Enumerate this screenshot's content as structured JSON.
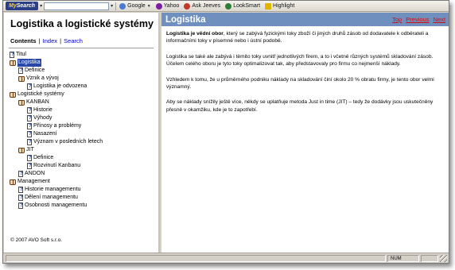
{
  "toolbar": {
    "logo_my": "My",
    "logo_search": "Search",
    "search_placeholder": "",
    "buttons": [
      {
        "label": "Google",
        "icon": "search-icon",
        "color": "#4a7bd0"
      },
      {
        "label": "Yahoo",
        "icon": "search-icon",
        "color": "#7b1fa2"
      },
      {
        "label": "Ask Jeeves",
        "icon": "search-icon",
        "color": "#c0392b"
      },
      {
        "label": "LookSmart",
        "icon": "search-icon",
        "color": "#2e7d32"
      },
      {
        "label": "Highlight",
        "icon": "highlighter-icon",
        "color": "#e0b400"
      }
    ]
  },
  "left_pane": {
    "title": "Logistika a logistické systémy",
    "nav": {
      "contents": "Contents",
      "index": "Index",
      "search": "Search",
      "separator": "|"
    },
    "tree": [
      {
        "label": "Titul",
        "icon": "page",
        "level": 0,
        "selected": false
      },
      {
        "label": "Logistika",
        "icon": "book",
        "level": 0,
        "selected": true
      },
      {
        "label": "Definice",
        "icon": "page",
        "level": 1,
        "selected": false
      },
      {
        "label": "Vznik a vývoj",
        "icon": "book",
        "level": 1,
        "selected": false
      },
      {
        "label": "Logistika je odvozena",
        "icon": "page",
        "level": 2,
        "selected": false
      },
      {
        "label": "Logistické systémy",
        "icon": "book",
        "level": 0,
        "selected": false
      },
      {
        "label": "KANBAN",
        "icon": "book",
        "level": 1,
        "selected": false
      },
      {
        "label": "Historie",
        "icon": "page",
        "level": 2,
        "selected": false
      },
      {
        "label": "Výhody",
        "icon": "page",
        "level": 2,
        "selected": false
      },
      {
        "label": "Přínosy a problémy",
        "icon": "page",
        "level": 2,
        "selected": false
      },
      {
        "label": "Nasazení",
        "icon": "page",
        "level": 2,
        "selected": false
      },
      {
        "label": "Význam v posledních letech",
        "icon": "page",
        "level": 2,
        "selected": false
      },
      {
        "label": "JIT",
        "icon": "book",
        "level": 1,
        "selected": false
      },
      {
        "label": "Definice",
        "icon": "page",
        "level": 2,
        "selected": false
      },
      {
        "label": "Rozvinutí Kanbanu",
        "icon": "page",
        "level": 2,
        "selected": false
      },
      {
        "label": "ANDON",
        "icon": "page",
        "level": 1,
        "selected": false
      },
      {
        "label": "Management",
        "icon": "book",
        "level": 0,
        "selected": false
      },
      {
        "label": "Historie managementu",
        "icon": "page",
        "level": 1,
        "selected": false
      },
      {
        "label": "Dělení managementu",
        "icon": "page",
        "level": 1,
        "selected": false
      },
      {
        "label": "Osobnosti managementu",
        "icon": "page",
        "level": 1,
        "selected": false
      }
    ],
    "copyright": "© 2007 AVO Soft s.r.o."
  },
  "content": {
    "title": "Logistika",
    "nav": {
      "top": "Top",
      "previous": "Previous",
      "next": "Next"
    },
    "paragraphs": [
      {
        "lead": "Logistika je vědní obor",
        "text": ", který se zabývá fyzickými toky zboží či jiných druhů zásob od dodavatele k odběrateli a informačními toky v písemné nebo i ústní podobě."
      },
      {
        "lead": "",
        "text": "Logistika se také ale zabývá i těmito toky uvnitř jednotlivých firem, a to i včetně různých systémů skladování zásob. Účelem celého oboru je tyto toky optimalizovat tak, aby představovaly pro firmu co nejmenší náklady."
      },
      {
        "lead": "",
        "text": "Vzhledem k tomu, že u průměrného podniku náklady na skladování činí okolo 20 % obratu firmy, je tento obor velmi významný."
      },
      {
        "lead": "",
        "text": "Aby se náklady snížily ještě více, někdy se uplatňuje metoda Just in time (JIT) – tedy že dodávky jsou uskutečněny přesně v okamžiku, kde je to zapotřebí."
      }
    ]
  },
  "status_bar": {
    "num": "NUM"
  },
  "colors": {
    "header_bar": "#6f8fbf",
    "selected_item": "#2848a8",
    "nav_link_left": "#0000cc",
    "nav_link_right": "#d01010"
  }
}
